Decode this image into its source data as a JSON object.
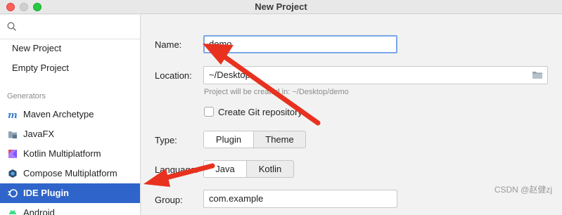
{
  "window": {
    "title": "New Project"
  },
  "sidebar": {
    "search_icon": "search-icon",
    "top_items": [
      {
        "label": "New Project"
      },
      {
        "label": "Empty Project"
      }
    ],
    "group_label": "Generators",
    "generators": [
      {
        "label": "Maven Archetype",
        "icon": "maven-icon"
      },
      {
        "label": "JavaFX",
        "icon": "javafx-icon"
      },
      {
        "label": "Kotlin Multiplatform",
        "icon": "kotlin-icon"
      },
      {
        "label": "Compose Multiplatform",
        "icon": "compose-icon"
      },
      {
        "label": "IDE Plugin",
        "icon": "ide-plugin-icon",
        "selected": true
      },
      {
        "label": "Android",
        "icon": "android-icon"
      }
    ]
  },
  "form": {
    "name_label": "Name:",
    "name_value": "demo",
    "location_label": "Location:",
    "location_value": "~/Desktop",
    "location_hint": "Project will be created in: ~/Desktop/demo",
    "git_label": "Create Git repository",
    "git_checked": false,
    "type_label": "Type:",
    "type_options": [
      "Plugin",
      "Theme"
    ],
    "type_selected": "Plugin",
    "language_label": "Language:",
    "language_options": [
      "Java",
      "Kotlin"
    ],
    "language_selected": "Java",
    "group_label": "Group:",
    "group_value": "com.example"
  },
  "annotations": {
    "arrow_color": "#e8311f"
  },
  "watermark": "CSDN @赵健zj",
  "colors": {
    "selection": "#2f65ca",
    "focus_border": "#7aa7e8"
  }
}
